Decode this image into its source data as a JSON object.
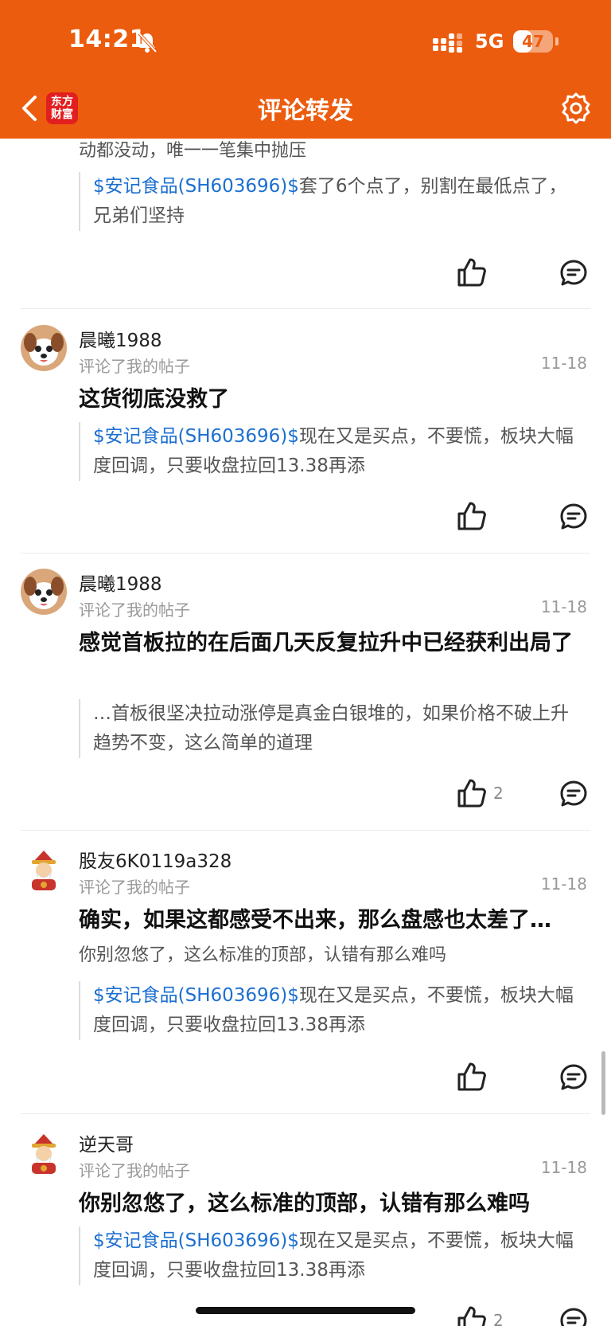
{
  "status_bar": {
    "time": "14:21",
    "network": "5G",
    "battery": "47",
    "battery_level": 0.47
  },
  "header": {
    "title": "评论转发",
    "logo_line1": "东方",
    "logo_line2": "财富"
  },
  "colors": {
    "brand": "#EC5C0E",
    "link": "#1C6FD1"
  },
  "top_fragment": {
    "reply": "动都没动，唯一一笔集中抛压",
    "quote_link": "$安记食品(SH603696)$",
    "quote_text": "套了6个点了，别割在最低点了，兄弟们坚持"
  },
  "cards": [
    {
      "username": "晨曦1988",
      "action": "评论了我的帖子",
      "date": "11-18",
      "comment": "这货彻底没救了",
      "quote_link": "$安记食品(SH603696)$",
      "quote_text": "现在又是买点，不要慌，板块大幅度回调，只要收盘拉回13.38再添",
      "avatar": "puppy-avatar"
    },
    {
      "username": "晨曦1988",
      "action": "评论了我的帖子",
      "date": "11-18",
      "comment": "感觉首板拉的在后面几天反复拉升中已经获利出局了",
      "quote_text": "…首板很坚决拉动涨停是真金白银堆的，如果价格不破上升趋势不变，这么简单的道理",
      "likes": "2",
      "avatar": "puppy-avatar"
    },
    {
      "username": "股友6K0119a328",
      "action": "评论了我的帖子",
      "date": "11-18",
      "comment": "确实，如果这都感受不出来，那么盘感也太差了…",
      "reply": "你别忽悠了，这么标准的顶部，认错有那么难吗",
      "quote_link": "$安记食品(SH603696)$",
      "quote_text": "现在又是买点，不要慌，板块大幅度回调，只要收盘拉回13.38再添",
      "avatar": "fortune-god-avatar"
    },
    {
      "username": "逆天哥",
      "action": "评论了我的帖子",
      "date": "11-18",
      "comment": "你别忽悠了，这么标准的顶部，认错有那么难吗",
      "quote_link": "$安记食品(SH603696)$",
      "quote_text": "现在又是买点，不要慌，板块大幅度回调，只要收盘拉回13.38再添",
      "likes": "2",
      "avatar": "fortune-god-avatar"
    }
  ]
}
